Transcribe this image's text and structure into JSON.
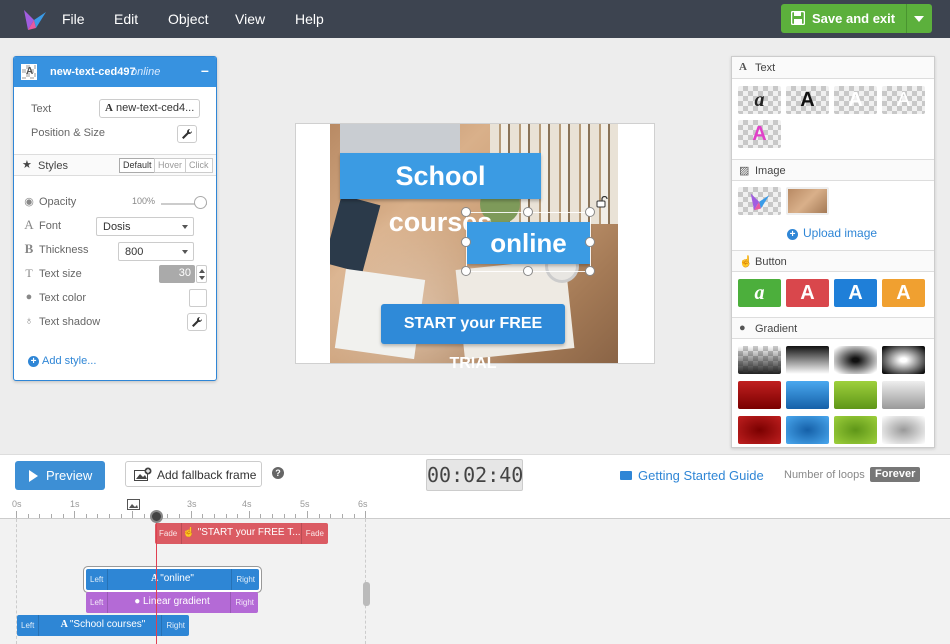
{
  "menu": [
    "File",
    "Edit",
    "Object",
    "View",
    "Help"
  ],
  "save_button": "Save and exit",
  "props": {
    "name": "new-text-ced497",
    "status": "online",
    "text_label": "Text",
    "text_value": "new-text-ced4...",
    "position_label": "Position & Size",
    "styles_label": "Styles",
    "state_tabs": [
      "Default",
      "Hover",
      "Click"
    ],
    "opacity_label": "Opacity",
    "opacity_value": "100%",
    "font_label": "Font",
    "font_value": "Dosis",
    "thickness_label": "Thickness",
    "thickness_value": "800",
    "text_size_label": "Text size",
    "text_size_value": "30",
    "text_color_label": "Text color",
    "text_shadow_label": "Text shadow",
    "add_style": "Add style..."
  },
  "canvas": {
    "banner_1": "School courses",
    "banner_2": "online",
    "banner_3": "START your FREE TRIAL"
  },
  "library": {
    "text_section": "Text",
    "image_section": "Image",
    "upload_label": "Upload image",
    "button_section": "Button",
    "gradient_section": "Gradient",
    "tile_letter": "A",
    "tile_letter_script": "a"
  },
  "toolbar": {
    "preview": "Preview",
    "fallback": "Add fallback frame",
    "help": "?",
    "time": "00:02:40",
    "guide": "Getting Started Guide",
    "loops_label": "Number of loops",
    "loops_value": "Forever"
  },
  "timeline": {
    "ticks": [
      "0s",
      "1s",
      "2s",
      "3s",
      "4s",
      "5s",
      "6s"
    ],
    "clips": [
      {
        "left": "Fade",
        "label": "\"START your FREE T...",
        "right": "Fade"
      },
      {
        "left": "Left",
        "label": "\"online\"",
        "right": "Right"
      },
      {
        "left": "Left",
        "label": "Linear gradient",
        "right": "Right"
      },
      {
        "left": "Left",
        "label": "\"School courses\"",
        "right": "Right"
      }
    ]
  },
  "colors": {
    "topbar": "#3d4450",
    "accent_blue": "#3792e0",
    "save_green": "#5cb03c",
    "banner_blue": "#3b9be3",
    "clip_red": "#db5b63",
    "clip_blue": "#2e86d5",
    "clip_purple": "#b46ad6"
  }
}
